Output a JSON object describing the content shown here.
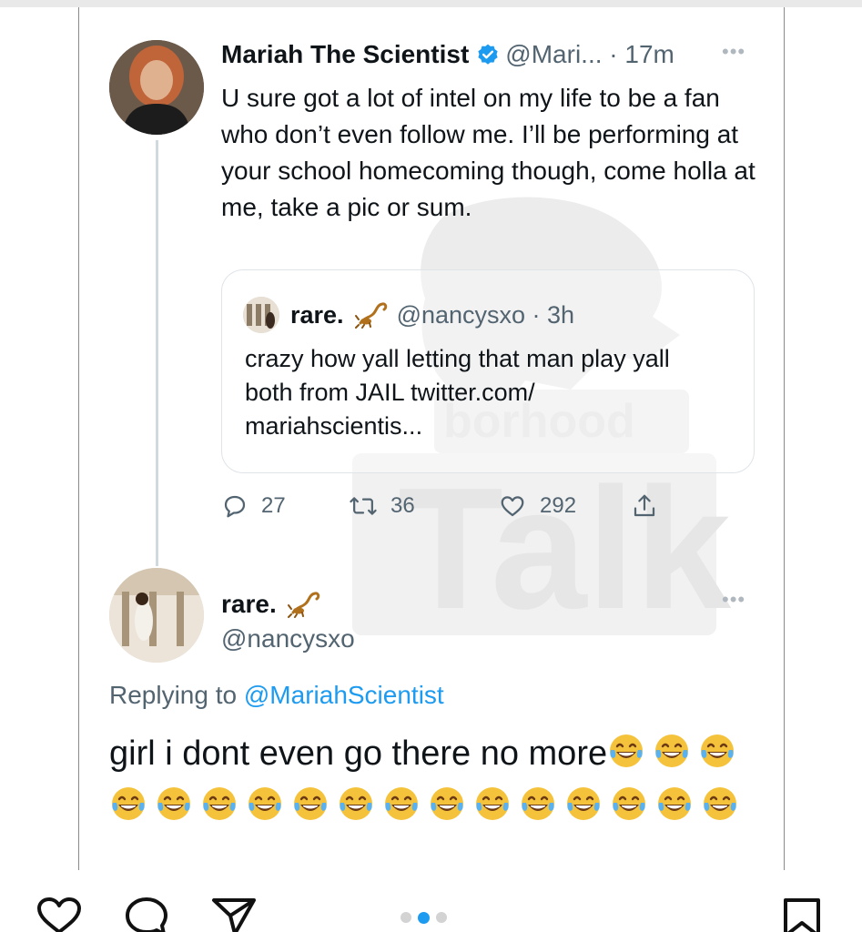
{
  "colors": {
    "accent": "#1d9bf0",
    "text": "#0f1419",
    "muted": "#536471"
  },
  "tweet": {
    "author": "Mariah The Scientist",
    "handle_time": "@Mari... · 17m",
    "text": "U sure got a lot of intel on my life to be a fan who don’t even follow me. I’ll be performing at your school homecoming though, come holla at me, take a pic or sum.",
    "quote": {
      "author": "rare.",
      "handle_time": "@nancysxo · 3h",
      "text": "crazy how yall letting that man play yall both from JAIL twitter.com/ mariahscientis..."
    },
    "stats": {
      "replies": "27",
      "retweets": "36",
      "likes": "292"
    }
  },
  "reply": {
    "author": "rare.",
    "handle": "@nancysxo",
    "replying_prefix": "Replying to ",
    "replying_mention": "@MariahScientist",
    "text": "girl i dont even go there no more",
    "emoji_count": 17
  },
  "carousel": {
    "current": 2,
    "total": 3
  }
}
